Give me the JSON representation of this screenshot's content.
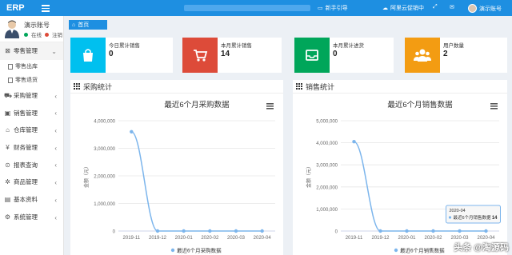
{
  "app": {
    "logo": "ERP"
  },
  "topbar": {
    "guide": "新手引导",
    "cloud": "阿里云促销中",
    "user": "演示账号",
    "colors": {
      "bar": "#1e8fe1"
    }
  },
  "user": {
    "name": "演示账号",
    "online": "在线",
    "logout": "注销"
  },
  "sidebar": {
    "items": [
      {
        "label": "零售管理",
        "icon": "cart-icon",
        "open": true,
        "children": [
          {
            "label": "零售出库"
          },
          {
            "label": "零售退货"
          }
        ]
      },
      {
        "label": "采购管理",
        "icon": "truck-icon"
      },
      {
        "label": "销售管理",
        "icon": "bag-icon"
      },
      {
        "label": "仓库管理",
        "icon": "home-icon"
      },
      {
        "label": "财务管理",
        "icon": "money-icon"
      },
      {
        "label": "报表查询",
        "icon": "search-icon"
      },
      {
        "label": "商品管理",
        "icon": "gear-icon"
      },
      {
        "label": "基本资料",
        "icon": "book-icon"
      },
      {
        "label": "系统管理",
        "icon": "cog-icon"
      }
    ]
  },
  "breadcrumb": {
    "home": "首页"
  },
  "stats": [
    {
      "label": "今日累计销售",
      "value": "0",
      "color": "#00c0ef",
      "icon": "bag-icon"
    },
    {
      "label": "本月累计销售",
      "value": "14",
      "color": "#dd4b39",
      "icon": "cart-icon"
    },
    {
      "label": "本月累计进货",
      "value": "0",
      "color": "#00a65a",
      "icon": "inbox-icon"
    },
    {
      "label": "用户数量",
      "value": "2",
      "color": "#f39c12",
      "icon": "users-icon"
    }
  ],
  "panels": {
    "purchase": {
      "heading": "采购统计"
    },
    "sales": {
      "heading": "销售统计"
    }
  },
  "credit": "Highcharts.com.cn",
  "watermark": "头条 @淘源码",
  "chart_data": [
    {
      "type": "line",
      "title": "最近6个月采购数据",
      "ylabel": "金额（元）",
      "categories": [
        "2019-11",
        "2019-12",
        "2020-01",
        "2020-02",
        "2020-03",
        "2020-04"
      ],
      "series": [
        {
          "name": "最近6个月采购数据",
          "values": [
            3600000,
            0,
            0,
            0,
            0,
            0
          ]
        }
      ],
      "ylim": [
        0,
        4000000
      ],
      "yticks": [
        "0",
        "1,000,000",
        "2,000,000",
        "3,000,000",
        "4,000,000"
      ],
      "color": "#7cb5ec"
    },
    {
      "type": "line",
      "title": "最近6个月销售数据",
      "ylabel": "金额（元）",
      "categories": [
        "2019-11",
        "2019-12",
        "2020-01",
        "2020-02",
        "2020-03",
        "2020-04"
      ],
      "series": [
        {
          "name": "最近6个月销售数据",
          "values": [
            4050000,
            0,
            0,
            0,
            0,
            14
          ]
        }
      ],
      "ylim": [
        0,
        5000000
      ],
      "yticks": [
        "0",
        "1,000,000",
        "2,000,000",
        "3,000,000",
        "4,000,000",
        "5,000,000"
      ],
      "color": "#7cb5ec",
      "tooltip": {
        "x": "2020-04",
        "series": "最近6个月销售数据",
        "value": "14"
      }
    }
  ]
}
